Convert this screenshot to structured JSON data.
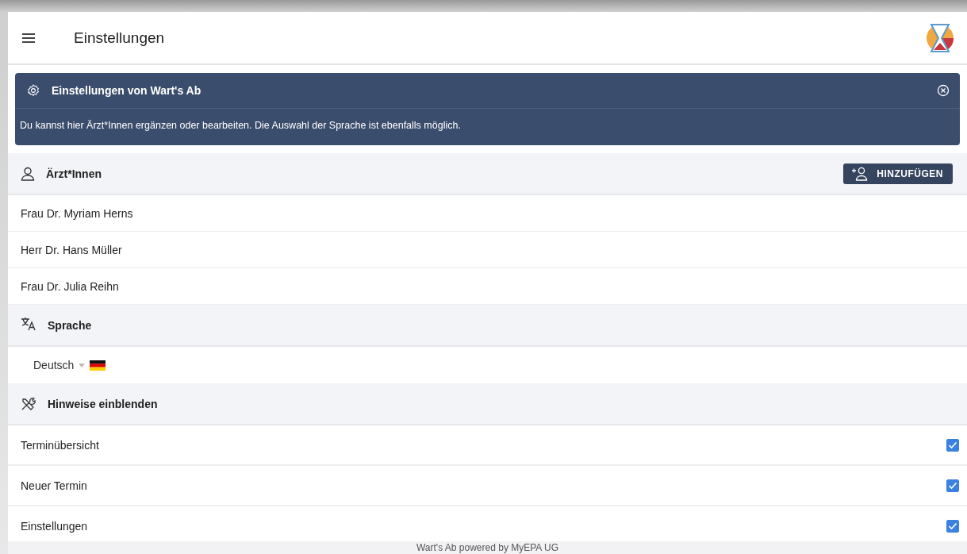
{
  "app_bar": {
    "title": "Einstellungen"
  },
  "info_banner": {
    "title": "Einstellungen von Wart's Ab",
    "message": "Du kannst hier Ärzt*Innen ergänzen oder bearbeiten. Die Auswahl der Sprache ist ebenfalls möglich."
  },
  "doctors": {
    "title": "Ärzt*Innen",
    "add_button": "HINZUFÜGEN",
    "items": [
      {
        "name": "Frau Dr. Myriam Herns"
      },
      {
        "name": "Herr Dr. Hans Müller"
      },
      {
        "name": "Frau Dr. Julia Reihn"
      }
    ]
  },
  "language": {
    "title": "Sprache",
    "value": "Deutsch"
  },
  "hints": {
    "title": "Hinweise einblenden",
    "items": [
      {
        "label": "Terminübersicht",
        "checked": true
      },
      {
        "label": "Neuer Termin",
        "checked": true
      },
      {
        "label": "Einstellungen",
        "checked": true
      }
    ]
  },
  "footer": "Wart's Ab powered by MyEPA UG"
}
